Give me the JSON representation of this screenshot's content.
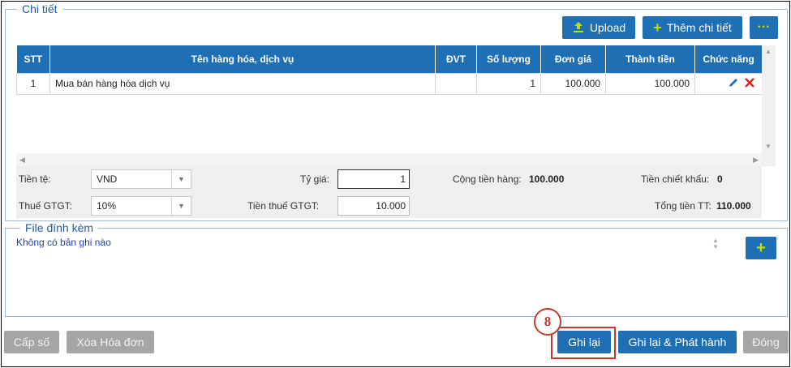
{
  "detail_section": {
    "legend": "Chi tiết",
    "upload_label": "Upload",
    "add_detail_label": "Thêm chi tiết",
    "more_label": "···"
  },
  "table": {
    "headers": [
      "STT",
      "Tên hàng hóa, dịch vụ",
      "ĐVT",
      "Số lượng",
      "Đơn giá",
      "Thành tiền",
      "Chức năng"
    ],
    "rows": [
      {
        "stt": "1",
        "name": "Mua bán hàng hóa dịch vụ",
        "unit": "",
        "qty": "1",
        "price": "100.000",
        "amount": "100.000"
      }
    ]
  },
  "summary": {
    "currency_label": "Tiền tệ:",
    "currency_value": "VND",
    "rate_label": "Tỷ giá:",
    "rate_value": "1",
    "goods_total_label": "Cộng tiền hàng:",
    "goods_total_value": "100.000",
    "discount_label": "Tiền chiết khấu:",
    "discount_value": "0",
    "vat_label": "Thuế GTGT:",
    "vat_value": "10%",
    "vat_amount_label": "Tiền thuế GTGT:",
    "vat_amount_value": "10.000",
    "grand_total_label": "Tổng tiền TT:",
    "grand_total_value": "110.000"
  },
  "attachments": {
    "legend": "File đính kèm",
    "empty_text": "Không có bản ghi nào",
    "add_label": "+"
  },
  "footer": {
    "issue_number_label": "Cấp số",
    "delete_invoice_label": "Xóa Hóa đơn",
    "save_label": "Ghi lại",
    "save_publish_label": "Ghi lại & Phát hành",
    "close_label": "Đóng"
  },
  "annotation": {
    "step_number": "8"
  },
  "colors": {
    "primary": "#1f6fb4",
    "disabled": "#a5a5a5",
    "accent_plus": "#b6e400",
    "highlight": "#c0392b",
    "delete_icon": "#e02020"
  }
}
